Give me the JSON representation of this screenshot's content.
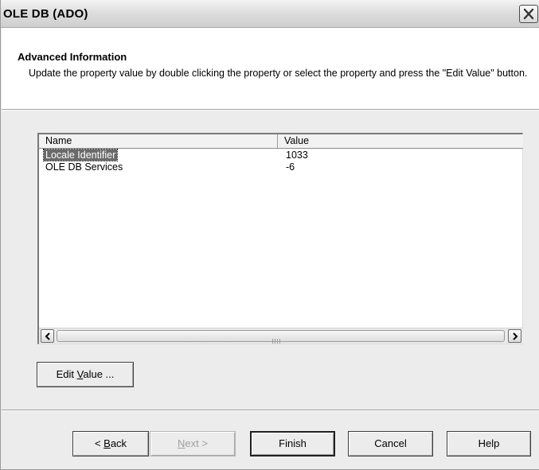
{
  "window": {
    "title": "OLE DB (ADO)",
    "close_icon": "close-icon"
  },
  "header": {
    "title": "Advanced Information",
    "description": "Update the property value by double clicking the property or select the property and press the \"Edit Value\" button."
  },
  "listview": {
    "columns": [
      "Name",
      "Value"
    ],
    "rows": [
      {
        "name": "Locale Identifier",
        "value": "1033",
        "selected": true
      },
      {
        "name": "OLE DB Services",
        "value": "-6",
        "selected": false
      }
    ]
  },
  "buttons": {
    "edit_value": {
      "pre": "Edit ",
      "mnemonic": "V",
      "post": "alue ..."
    },
    "back": {
      "pre": "< ",
      "mnemonic": "B",
      "post": "ack"
    },
    "next": {
      "mnemonic": "N",
      "post": "ext >"
    },
    "finish": "Finish",
    "cancel": "Cancel",
    "help": "Help"
  }
}
